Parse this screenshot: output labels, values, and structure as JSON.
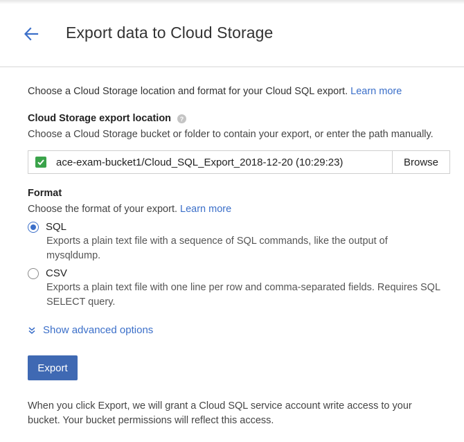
{
  "header": {
    "back_icon": "arrow-back-icon",
    "title": "Export data to Cloud Storage"
  },
  "intro": {
    "text": "Choose a Cloud Storage location and format for your Cloud SQL export.",
    "link": "Learn more"
  },
  "location": {
    "label": "Cloud Storage export location",
    "help_icon": "help-icon",
    "description": "Choose a Cloud Storage bucket or folder to contain your export, or enter the path manually.",
    "path_value": "ace-exam-bucket1/Cloud_SQL_Export_2018-12-20 (10:29:23)",
    "browse_label": "Browse"
  },
  "format": {
    "label": "Format",
    "description": "Choose the format of your export.",
    "link": "Learn more",
    "options": [
      {
        "label": "SQL",
        "selected": true,
        "description": "Exports a plain text file with a sequence of SQL commands, like the output of mysqldump."
      },
      {
        "label": "CSV",
        "selected": false,
        "description": "Exports a plain text file with one line per row and comma-separated fields. Requires SQL SELECT query."
      }
    ]
  },
  "advanced": {
    "icon": "chevron-double-down-icon",
    "label": "Show advanced options"
  },
  "actions": {
    "export_label": "Export"
  },
  "footer": {
    "note": "When you click Export, we will grant a Cloud SQL service account write access to your bucket. Your bucket permissions will reflect this access."
  },
  "colors": {
    "accent": "#3b6fc9",
    "primary_button": "#3f69b3",
    "check_green": "#3aa34a"
  }
}
